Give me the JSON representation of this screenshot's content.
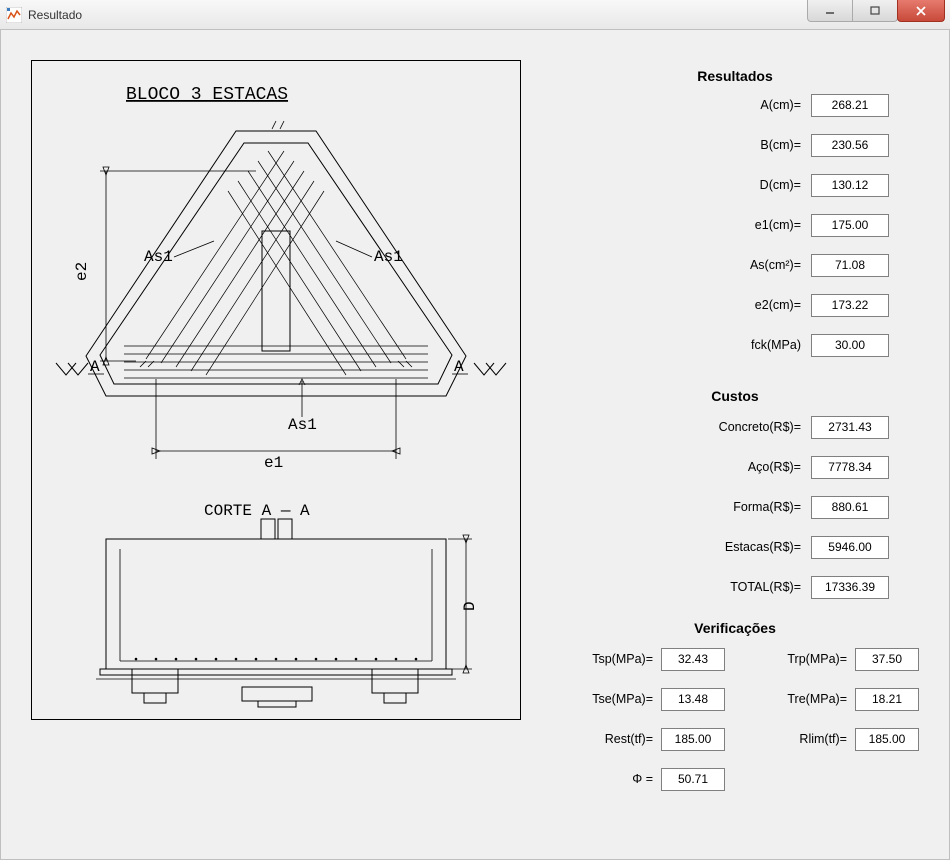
{
  "window": {
    "title": "Resultado"
  },
  "diagram": {
    "heading": "BLOCO 3 ESTACAS",
    "label_as1": "As1",
    "label_e1": "e1",
    "label_e2": "e2",
    "label_a": "A",
    "section_label": "CORTE  A — A",
    "label_d": "D"
  },
  "sections": {
    "resultados_title": "Resultados",
    "custos_title": "Custos",
    "verif_title": "Verificações"
  },
  "resultados": {
    "a_label": "A(cm)=",
    "a_value": "268.21",
    "b_label": "B(cm)=",
    "b_value": "230.56",
    "d_label": "D(cm)=",
    "d_value": "130.12",
    "e1_label": "e1(cm)=",
    "e1_value": "175.00",
    "as_label": "As(cm²)=",
    "as_value": "71.08",
    "e2_label": "e2(cm)=",
    "e2_value": "173.22",
    "fck_label": "fck(MPa)",
    "fck_value": "30.00"
  },
  "custos": {
    "concreto_label": "Concreto(R$)=",
    "concreto_value": "2731.43",
    "aco_label": "Aço(R$)=",
    "aco_value": "7778.34",
    "forma_label": "Forma(R$)=",
    "forma_value": "880.61",
    "estacas_label": "Estacas(R$)=",
    "estacas_value": "5946.00",
    "total_label": "TOTAL(R$)=",
    "total_value": "17336.39"
  },
  "verif": {
    "tsp_label": "Tsp(MPa)=",
    "tsp_value": "32.43",
    "trp_label": "Trp(MPa)=",
    "trp_value": "37.50",
    "tse_label": "Tse(MPa)=",
    "tse_value": "13.48",
    "tre_label": "Tre(MPa)=",
    "tre_value": "18.21",
    "rest_label": "Rest(tf)=",
    "rest_value": "185.00",
    "rlim_label": "Rlim(tf)=",
    "rlim_value": "185.00",
    "phi_label": "Φ =",
    "phi_value": "50.71"
  }
}
